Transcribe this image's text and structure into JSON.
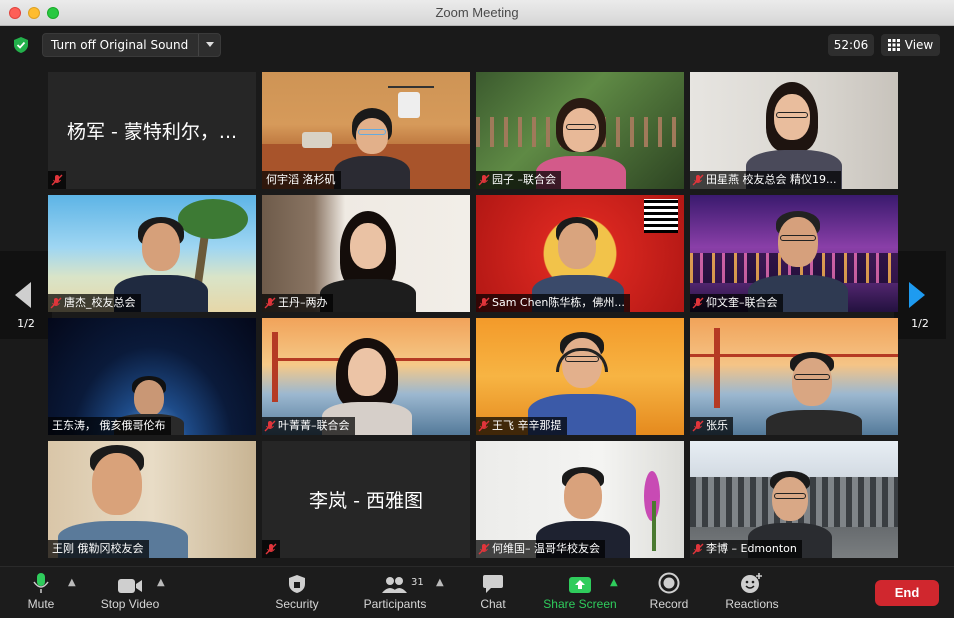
{
  "window": {
    "title": "Zoom Meeting"
  },
  "topbar": {
    "original_sound_label": "Turn off Original Sound",
    "timer": "52:06",
    "view_label": "View"
  },
  "paging": {
    "left": "1/2",
    "right": "1/2"
  },
  "tiles": [
    {
      "name": "杨军 - 蒙特利尔，...",
      "display": "bigname",
      "muted": true
    },
    {
      "name": "何宇滔 洛杉矶",
      "display": "video",
      "muted": false,
      "active": true
    },
    {
      "name": "园子 –联合会",
      "display": "video",
      "muted": true
    },
    {
      "name": "田星燕 校友总会 精仪19...",
      "display": "video",
      "muted": true
    },
    {
      "name": "唐杰_校友总会",
      "display": "video",
      "muted": true
    },
    {
      "name": "王丹–两办",
      "display": "video",
      "muted": true
    },
    {
      "name": "Sam Chen陈华栋，佛州...",
      "display": "video",
      "muted": true
    },
    {
      "name": "仰文奎–联合会",
      "display": "video",
      "muted": true
    },
    {
      "name": "王东涛， 俄亥俄哥伦布",
      "display": "video",
      "muted": false
    },
    {
      "name": "叶菁菁–联合会",
      "display": "video",
      "muted": true
    },
    {
      "name": "王飞 辛辛那提",
      "display": "video",
      "muted": true
    },
    {
      "name": "张乐",
      "display": "video",
      "muted": true
    },
    {
      "name": "王刚 俄勒冈校友会",
      "display": "video",
      "muted": false
    },
    {
      "name": "李岚 - 西雅图",
      "display": "bigname",
      "muted": true
    },
    {
      "name": "何维国– 温哥华校友会",
      "display": "video",
      "muted": true
    },
    {
      "name": "李博 – Edmonton",
      "display": "video",
      "muted": true
    }
  ],
  "toolbar": {
    "mute": "Mute",
    "stop_video": "Stop Video",
    "security": "Security",
    "participants": "Participants",
    "participants_count": "31",
    "chat": "Chat",
    "share_screen": "Share Screen",
    "record": "Record",
    "reactions": "Reactions",
    "end": "End"
  },
  "colors": {
    "active_speaker_outline": "#c5e270",
    "share_green": "#2fcc5c",
    "end_red": "#d0272e",
    "mute_red": "#e0353b"
  }
}
